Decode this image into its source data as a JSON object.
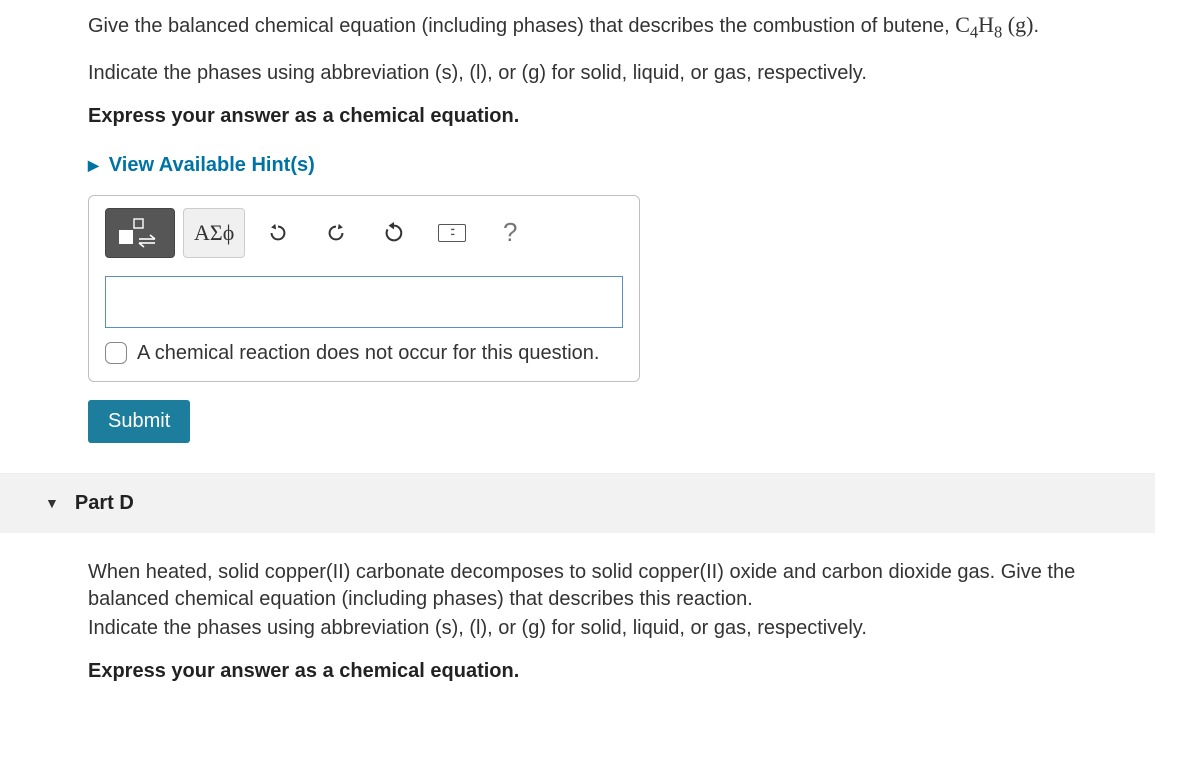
{
  "question": {
    "line1_prefix": "Give the balanced chemical equation (including phases) that describes the combustion of butene, ",
    "formula_base": "C",
    "formula_sub1": "4",
    "formula_mid": "H",
    "formula_sub2": "8",
    "formula_phase": " (g)",
    "formula_end": ".",
    "line2": "Indicate the phases using abbreviation (s), (l), or (g) for solid, liquid, or gas, respectively.",
    "line3": "Express your answer as a chemical equation."
  },
  "hints": {
    "label": "View Available Hint(s)",
    "glyph": "▶"
  },
  "editor": {
    "greek_label": "ΑΣϕ",
    "help_label": "?",
    "input_value": "",
    "no_reaction_label": "A chemical reaction does not occur for this question."
  },
  "submit_label": "Submit",
  "partD": {
    "glyph": "▼",
    "title": "Part D",
    "body1": "When heated, solid copper(II) carbonate decomposes to solid copper(II) oxide and carbon dioxide gas. Give the balanced chemical equation (including phases) that describes this reaction.",
    "body2": "Indicate the phases using abbreviation (s), (l), or (g) for solid, liquid, or gas, respectively.",
    "body3": "Express your answer as a chemical equation."
  }
}
